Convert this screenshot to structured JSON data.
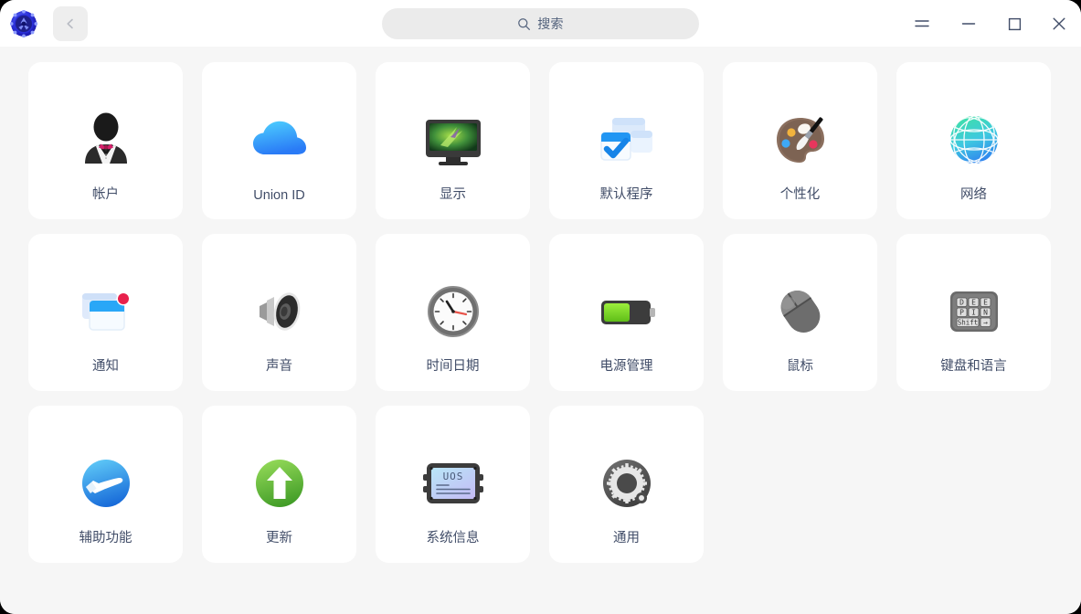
{
  "window": {
    "app_logo_icon": "settings-gear-logo",
    "background_color": "#f6f6f6",
    "card_color": "#ffffff",
    "label_color": "#414d68"
  },
  "titlebar": {
    "back_button": {
      "icon": "chevron-left-icon",
      "enabled": false
    },
    "search": {
      "placeholder": "搜索",
      "icon": "search-icon",
      "value": ""
    },
    "controls": [
      {
        "name": "menu",
        "icon": "hamburger-menu-icon"
      },
      {
        "name": "minimize",
        "icon": "minimize-icon"
      },
      {
        "name": "maximize",
        "icon": "maximize-icon"
      },
      {
        "name": "close",
        "icon": "close-icon"
      }
    ]
  },
  "grid": {
    "columns": 6,
    "items": [
      {
        "id": "accounts",
        "label": "帐户",
        "icon": "person-tuxedo-icon"
      },
      {
        "id": "union-id",
        "label": "Union ID",
        "icon": "cloud-icon"
      },
      {
        "id": "display",
        "label": "显示",
        "icon": "monitor-icon"
      },
      {
        "id": "default-apps",
        "label": "默认程序",
        "icon": "windows-check-icon"
      },
      {
        "id": "personalize",
        "label": "个性化",
        "icon": "paint-palette-icon"
      },
      {
        "id": "network",
        "label": "网络",
        "icon": "globe-icon"
      },
      {
        "id": "notifications",
        "label": "通知",
        "icon": "notification-window-badge-icon"
      },
      {
        "id": "sound",
        "label": "声音",
        "icon": "speaker-icon"
      },
      {
        "id": "datetime",
        "label": "时间日期",
        "icon": "clock-icon"
      },
      {
        "id": "power",
        "label": "电源管理",
        "icon": "battery-icon"
      },
      {
        "id": "mouse",
        "label": "鼠标",
        "icon": "mouse-icon"
      },
      {
        "id": "keyboard",
        "label": "键盘和语言",
        "icon": "keyboard-icon"
      },
      {
        "id": "accessibility",
        "label": "辅助功能",
        "icon": "helping-hand-icon"
      },
      {
        "id": "update",
        "label": "更新",
        "icon": "green-up-arrow-icon"
      },
      {
        "id": "system-info",
        "label": "系统信息",
        "icon": "uos-chip-icon"
      },
      {
        "id": "general",
        "label": "通用",
        "icon": "gear-icon"
      }
    ]
  }
}
